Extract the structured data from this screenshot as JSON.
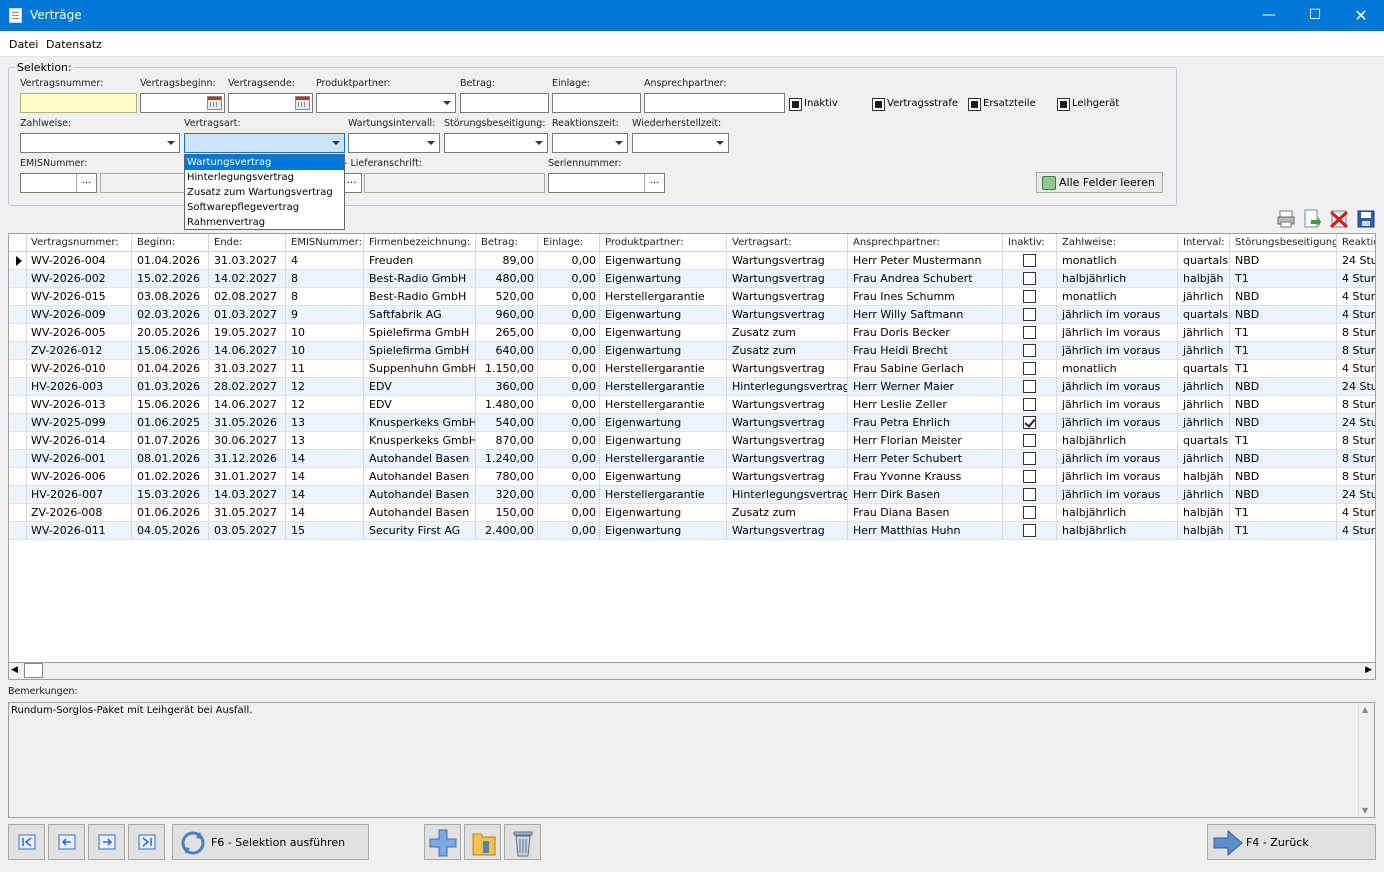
{
  "window": {
    "title": "Verträge"
  },
  "menu": [
    "Datei",
    "Datensatz"
  ],
  "selection": {
    "legend": "Selektion:",
    "labels": {
      "vertragsnummer": "Vertragsnummer:",
      "vertragsbeginn": "Vertragsbeginn:",
      "vertragsende": "Vertragsende:",
      "produktpartner": "Produktpartner:",
      "betrag": "Betrag:",
      "einlage": "Einlage:",
      "ansprechpartner": "Ansprechpartner:",
      "zahlweise": "Zahlweise:",
      "vertragsart": "Vertragsart:",
      "wartungsintervall": "Wartungsintervall:",
      "stoerungsbeseitigung": "Störungsbeseitigung:",
      "reaktionszeit": "Reaktionszeit:",
      "wiederherstellzeit": "Wiederherstellzeit:",
      "emisnummer": "EMISNummer:",
      "lieferanschrift": "- Lieferanschrift:",
      "seriennummer": "Seriennummer:"
    },
    "checkboxes": {
      "inaktiv": "Inaktiv",
      "vertragsstrafe": "Vertragsstrafe",
      "ersatzteile": "Ersatzteile",
      "leihgeraet": "Leihgerät"
    },
    "ellipsis": "...",
    "clear_button": "Alle Felder leeren",
    "vertragsart_options": [
      "Wartungsvertrag",
      "Hinterlegungsvertrag",
      "Zusatz zum Wartungsvertrag",
      "Softwarepflegevertrag",
      "Rahmenvertrag"
    ]
  },
  "grid": {
    "headers": [
      "Vertragsnummer:",
      "Beginn:",
      "Ende:",
      "EMISNummer:",
      "Firmenbezeichnung:",
      "Betrag:",
      "Einlage:",
      "Produktpartner:",
      "Vertragsart:",
      "Ansprechpartner:",
      "Inaktiv:",
      "Zahlweise:",
      "Interval:",
      "Störungsbeseitigung:",
      "Reaktic"
    ],
    "rows": [
      {
        "nr": "WV-2026-004",
        "beginn": "01.04.2026",
        "ende": "31.03.2027",
        "emis": "4",
        "firma": "Freuden",
        "betrag": "89,00",
        "einlage": "0,00",
        "partner": "Eigenwartung",
        "art": "Wartungsvertrag",
        "ansprech": "Herr Peter Mustermann",
        "inaktiv": false,
        "zahlweise": "monatlich",
        "interval": "quartals",
        "stoerung": "NBD",
        "reaktion": "24 Stun"
      },
      {
        "nr": "WV-2026-002",
        "beginn": "15.02.2026",
        "ende": "14.02.2027",
        "emis": "8",
        "firma": "Best-Radio GmbH",
        "betrag": "480,00",
        "einlage": "0,00",
        "partner": "Eigenwartung",
        "art": "Wartungsvertrag",
        "ansprech": "Frau Andrea Schubert",
        "inaktiv": false,
        "zahlweise": "halbjährlich",
        "interval": "halbjäh",
        "stoerung": "T1",
        "reaktion": "4 Stun"
      },
      {
        "nr": "WV-2026-015",
        "beginn": "03.08.2026",
        "ende": "02.08.2027",
        "emis": "8",
        "firma": "Best-Radio GmbH",
        "betrag": "520,00",
        "einlage": "0,00",
        "partner": "Herstellergarantie",
        "art": "Wartungsvertrag",
        "ansprech": "Frau Ines Schumm",
        "inaktiv": false,
        "zahlweise": "monatlich",
        "interval": "jährlich",
        "stoerung": "NBD",
        "reaktion": "4 Stun"
      },
      {
        "nr": "WV-2026-009",
        "beginn": "02.03.2026",
        "ende": "01.03.2027",
        "emis": "9",
        "firma": "Saftfabrik AG",
        "betrag": "960,00",
        "einlage": "0,00",
        "partner": "Eigenwartung",
        "art": "Wartungsvertrag",
        "ansprech": "Herr Willy Saftmann",
        "inaktiv": false,
        "zahlweise": "jährlich im voraus",
        "interval": "quartals",
        "stoerung": "NBD",
        "reaktion": "4 Stun"
      },
      {
        "nr": "WV-2026-005",
        "beginn": "20.05.2026",
        "ende": "19.05.2027",
        "emis": "10",
        "firma": "Spielefirma GmbH",
        "betrag": "265,00",
        "einlage": "0,00",
        "partner": "Eigenwartung",
        "art": "Zusatz zum",
        "ansprech": "Frau Doris Becker",
        "inaktiv": false,
        "zahlweise": "jährlich im voraus",
        "interval": "jährlich",
        "stoerung": "T1",
        "reaktion": "8 Stun"
      },
      {
        "nr": "ZV-2026-012",
        "beginn": "15.06.2026",
        "ende": "14.06.2027",
        "emis": "10",
        "firma": "Spielefirma GmbH",
        "betrag": "640,00",
        "einlage": "0,00",
        "partner": "Eigenwartung",
        "art": "Zusatz zum",
        "ansprech": "Frau Heidi Brecht",
        "inaktiv": false,
        "zahlweise": "jährlich im voraus",
        "interval": "jährlich",
        "stoerung": "T1",
        "reaktion": "8 Stun"
      },
      {
        "nr": "WV-2026-010",
        "beginn": "01.04.2026",
        "ende": "31.03.2027",
        "emis": "11",
        "firma": "Suppenhuhn GmbH",
        "betrag": "1.150,00",
        "einlage": "0,00",
        "partner": "Herstellergarantie",
        "art": "Wartungsvertrag",
        "ansprech": "Frau Sabine Gerlach",
        "inaktiv": false,
        "zahlweise": "monatlich",
        "interval": "quartals",
        "stoerung": "T1",
        "reaktion": "4 Stun"
      },
      {
        "nr": "HV-2026-003",
        "beginn": "01.03.2026",
        "ende": "28.02.2027",
        "emis": "12",
        "firma": "EDV",
        "betrag": "360,00",
        "einlage": "0,00",
        "partner": "Herstellergarantie",
        "art": "Hinterlegungsvertrag",
        "ansprech": "Herr Werner Maier",
        "inaktiv": false,
        "zahlweise": "jährlich im voraus",
        "interval": "jährlich",
        "stoerung": "NBD",
        "reaktion": "24 Stun"
      },
      {
        "nr": "WV-2026-013",
        "beginn": "15.06.2026",
        "ende": "14.06.2027",
        "emis": "12",
        "firma": "EDV",
        "betrag": "1.480,00",
        "einlage": "0,00",
        "partner": "Herstellergarantie",
        "art": "Wartungsvertrag",
        "ansprech": "Herr Leslie Zeller",
        "inaktiv": false,
        "zahlweise": "jährlich im voraus",
        "interval": "jährlich",
        "stoerung": "NBD",
        "reaktion": "8 Stun"
      },
      {
        "nr": "WV-2025-099",
        "beginn": "01.06.2025",
        "ende": "31.05.2026",
        "emis": "13",
        "firma": "Knusperkeks GmbH",
        "betrag": "540,00",
        "einlage": "0,00",
        "partner": "Eigenwartung",
        "art": "Wartungsvertrag",
        "ansprech": "Frau Petra Ehrlich",
        "inaktiv": true,
        "zahlweise": "jährlich im voraus",
        "interval": "jährlich",
        "stoerung": "NBD",
        "reaktion": "24 Stun"
      },
      {
        "nr": "WV-2026-014",
        "beginn": "01.07.2026",
        "ende": "30.06.2027",
        "emis": "13",
        "firma": "Knusperkeks GmbH",
        "betrag": "870,00",
        "einlage": "0,00",
        "partner": "Eigenwartung",
        "art": "Wartungsvertrag",
        "ansprech": "Herr Florian Meister",
        "inaktiv": false,
        "zahlweise": "halbjährlich",
        "interval": "quartals",
        "stoerung": "T1",
        "reaktion": "8 Stun"
      },
      {
        "nr": "WV-2026-001",
        "beginn": "08.01.2026",
        "ende": "31.12.2026",
        "emis": "14",
        "firma": "Autohandel Basen",
        "betrag": "1.240,00",
        "einlage": "0,00",
        "partner": "Herstellergarantie",
        "art": "Wartungsvertrag",
        "ansprech": "Herr Peter Schubert",
        "inaktiv": false,
        "zahlweise": "jährlich im voraus",
        "interval": "jährlich",
        "stoerung": "NBD",
        "reaktion": "8 Stun"
      },
      {
        "nr": "WV-2026-006",
        "beginn": "01.02.2026",
        "ende": "31.01.2027",
        "emis": "14",
        "firma": "Autohandel Basen",
        "betrag": "780,00",
        "einlage": "0,00",
        "partner": "Eigenwartung",
        "art": "Wartungsvertrag",
        "ansprech": "Frau Yvonne Krauss",
        "inaktiv": false,
        "zahlweise": "jährlich im voraus",
        "interval": "halbjäh",
        "stoerung": "NBD",
        "reaktion": "8 Stun"
      },
      {
        "nr": "HV-2026-007",
        "beginn": "15.03.2026",
        "ende": "14.03.2027",
        "emis": "14",
        "firma": "Autohandel Basen",
        "betrag": "320,00",
        "einlage": "0,00",
        "partner": "Herstellergarantie",
        "art": "Hinterlegungsvertrag",
        "ansprech": "Herr Dirk Basen",
        "inaktiv": false,
        "zahlweise": "jährlich im voraus",
        "interval": "jährlich",
        "stoerung": "NBD",
        "reaktion": "24 Stun"
      },
      {
        "nr": "ZV-2026-008",
        "beginn": "01.06.2026",
        "ende": "31.05.2027",
        "emis": "14",
        "firma": "Autohandel Basen",
        "betrag": "150,00",
        "einlage": "0,00",
        "partner": "Eigenwartung",
        "art": "Zusatz zum",
        "ansprech": "Frau Diana Basen",
        "inaktiv": false,
        "zahlweise": "halbjährlich",
        "interval": "halbjäh",
        "stoerung": "T1",
        "reaktion": "4 Stun"
      },
      {
        "nr": "WV-2026-011",
        "beginn": "04.05.2026",
        "ende": "03.05.2027",
        "emis": "15",
        "firma": "Security First AG",
        "betrag": "2.400,00",
        "einlage": "0,00",
        "partner": "Eigenwartung",
        "art": "Wartungsvertrag",
        "ansprech": "Herr Matthias Huhn",
        "inaktiv": false,
        "zahlweise": "halbjährlich",
        "interval": "halbjäh",
        "stoerung": "T1",
        "reaktion": "4 Stun"
      }
    ]
  },
  "remarks": {
    "label": "Bemerkungen:",
    "text": "Rundum-Sorglos-Paket mit Leihgerät bei Ausfall."
  },
  "footer": {
    "run_selection": "F6 - Selektion ausführen",
    "back": "F4 - Zurück"
  },
  "icons": {
    "first": "first-record-icon",
    "prev": "prev-record-icon",
    "next": "next-record-icon",
    "last": "last-record-icon",
    "run": "refresh-icon",
    "add": "add-icon",
    "edit": "edit-folder-icon",
    "trash": "trash-icon",
    "back": "arrow-right-icon",
    "print": "print-icon",
    "export": "export-icon",
    "delete": "delete-icon",
    "save": "save-icon"
  },
  "colors": {
    "titlebar": "#0078d7",
    "row_alt": "#ebf3fb",
    "selected": "#0078d7",
    "required": "#fffdc5"
  }
}
